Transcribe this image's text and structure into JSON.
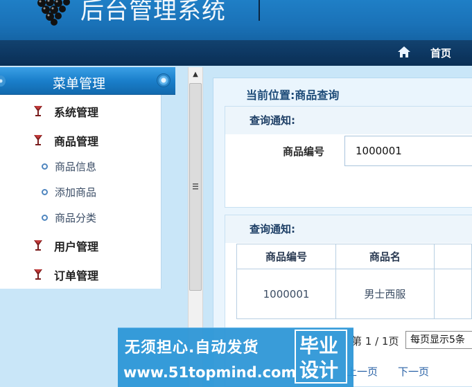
{
  "header": {
    "title": "后台管理系统",
    "colors": {
      "header_blue": "#1a72b8",
      "nav_dark": "#0d3761"
    }
  },
  "navbar": {
    "home_icon": "home-icon",
    "home_label": "首页"
  },
  "sidebar": {
    "title": "菜单管理",
    "groups": [
      {
        "label": "系统管理",
        "icon": "cup-icon"
      },
      {
        "label": "商品管理",
        "icon": "cup-icon"
      },
      {
        "label": "用户管理",
        "icon": "cup-icon"
      },
      {
        "label": "订单管理",
        "icon": "cup-icon"
      }
    ],
    "sub_items": [
      {
        "label": "商品信息"
      },
      {
        "label": "添加商品"
      },
      {
        "label": "商品分类"
      }
    ]
  },
  "main": {
    "location": "当前位置:商品查询",
    "query_panel": {
      "title": "查询通知:",
      "field_label": "商品编号",
      "field_value": "1000001"
    },
    "result_panel": {
      "title": "查询通知:",
      "columns": [
        "商品编号",
        "商品名"
      ],
      "rows": [
        [
          "1000001",
          "男士西服"
        ]
      ]
    },
    "pager": {
      "page_info": "第 1 / 1页",
      "page_size": "每页显示5条",
      "prev": "上一页",
      "next": "下一页"
    }
  },
  "watermark": {
    "line1": "无须担心.自动发货",
    "line2": "www.51topmind.com",
    "box_line1": "毕业",
    "box_line2": "设计"
  }
}
